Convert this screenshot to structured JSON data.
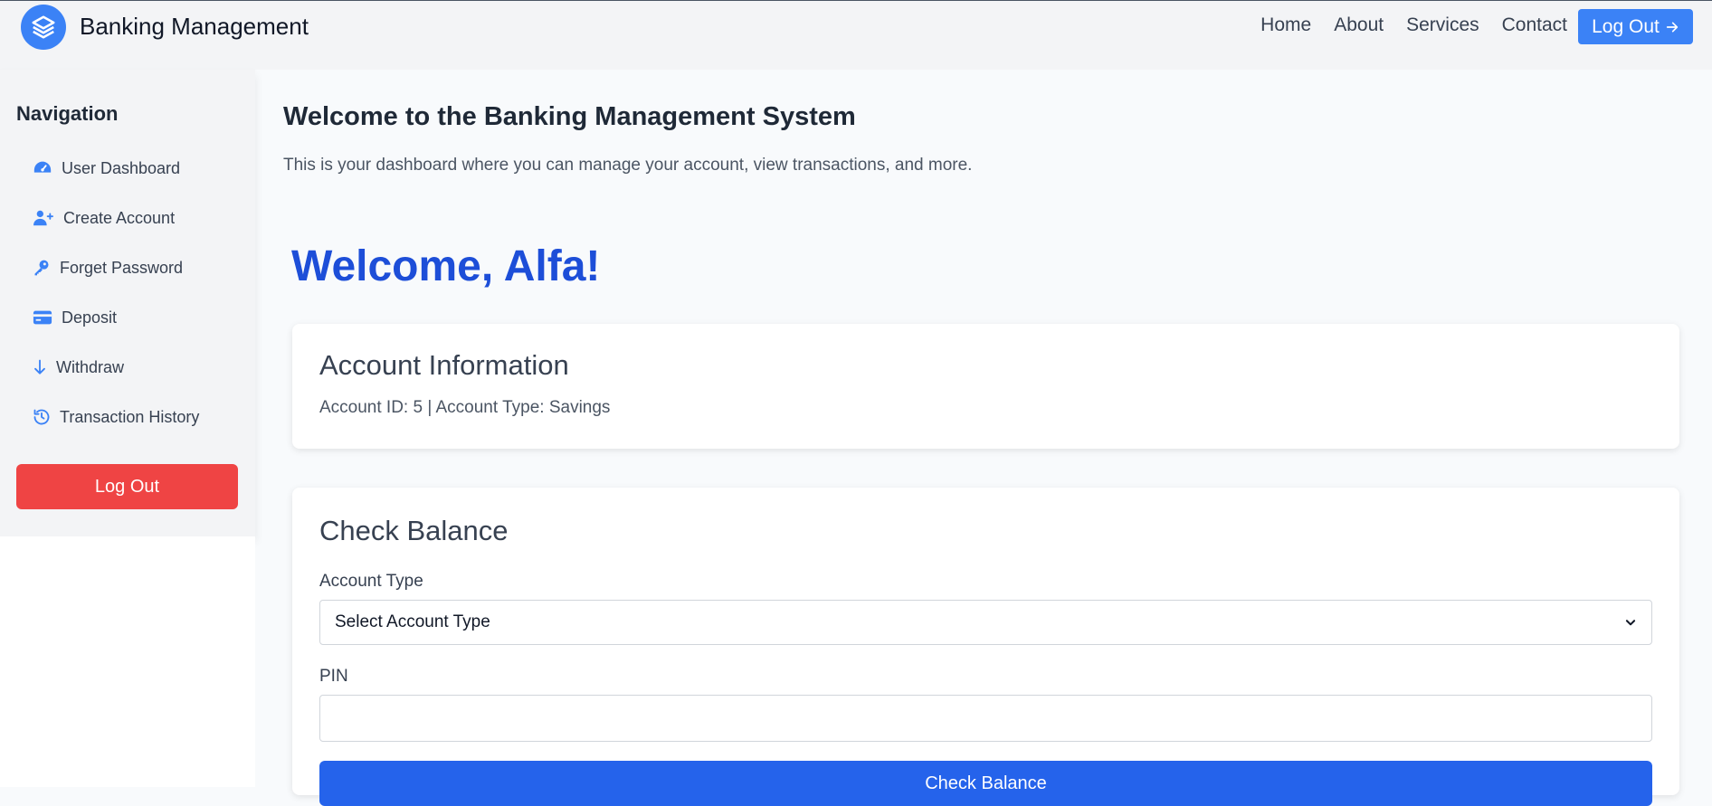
{
  "header": {
    "brand": "Banking Management",
    "nav": [
      "Home",
      "About",
      "Services",
      "Contact"
    ],
    "logout_label": "Log Out"
  },
  "sidebar": {
    "title": "Navigation",
    "items": [
      {
        "label": "User Dashboard",
        "icon": "gauge-icon"
      },
      {
        "label": "Create Account",
        "icon": "user-plus-icon"
      },
      {
        "label": "Forget Password",
        "icon": "key-icon"
      },
      {
        "label": "Deposit",
        "icon": "credit-card-icon"
      },
      {
        "label": "Withdraw",
        "icon": "arrow-down-icon"
      },
      {
        "label": "Transaction History",
        "icon": "history-icon"
      }
    ],
    "logout_label": "Log Out"
  },
  "main": {
    "title": "Welcome to the Banking Management System",
    "subtitle": "This is your dashboard where you can manage your account, view transactions, and more.",
    "welcome": "Welcome, Alfa!",
    "account_info": {
      "heading": "Account Information",
      "details": "Account ID: 5 | Account Type: Savings"
    },
    "check_balance": {
      "heading": "Check Balance",
      "account_type_label": "Account Type",
      "account_type_value": "Select Account Type",
      "pin_label": "PIN",
      "pin_value": "",
      "button_label": "Check Balance"
    }
  },
  "colors": {
    "accent": "#3b82f6",
    "danger": "#ef4444",
    "primary_button": "#2563eb",
    "welcome": "#1d4ed8"
  }
}
